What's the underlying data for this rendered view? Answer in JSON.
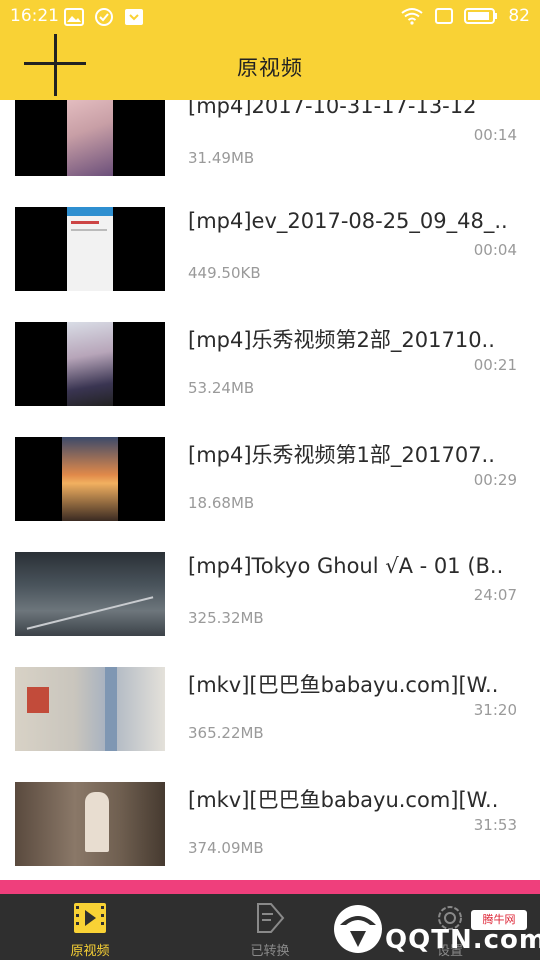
{
  "status_bar": {
    "time": "16:21",
    "battery": "82"
  },
  "header": {
    "title": "原视频",
    "add_icon": "plus-icon"
  },
  "colors": {
    "accent": "#f9d235",
    "pink": "#ef3f7c",
    "nav_bg": "#2f2f2f",
    "text_secondary": "#9a9a9a"
  },
  "videos": [
    {
      "name": "[mp4]2017-10-31-17-13-12",
      "duration": "00:14",
      "size": "31.49MB"
    },
    {
      "name": "[mp4]ev_2017-08-25_09_48_..",
      "duration": "00:04",
      "size": "449.50KB"
    },
    {
      "name": "[mp4]乐秀视频第2部_201710..",
      "duration": "00:21",
      "size": "53.24MB"
    },
    {
      "name": "[mp4]乐秀视频第1部_201707..",
      "duration": "00:29",
      "size": "18.68MB"
    },
    {
      "name": "[mp4]Tokyo Ghoul √A - 01 (B..",
      "duration": "24:07",
      "size": "325.32MB"
    },
    {
      "name": "[mkv][巴巴鱼babayu.com][W..",
      "duration": "31:20",
      "size": "365.22MB"
    },
    {
      "name": "[mkv][巴巴鱼babayu.com][W..",
      "duration": "31:53",
      "size": "374.09MB"
    }
  ],
  "bottom_nav": [
    {
      "label": "原视频",
      "icon": "film-icon",
      "active": true
    },
    {
      "label": "已转换",
      "icon": "converted-icon",
      "active": false
    },
    {
      "label": "设置",
      "icon": "settings-icon",
      "active": false
    }
  ],
  "watermark": {
    "badge": "腾牛网",
    "text": "QQTN.com"
  }
}
